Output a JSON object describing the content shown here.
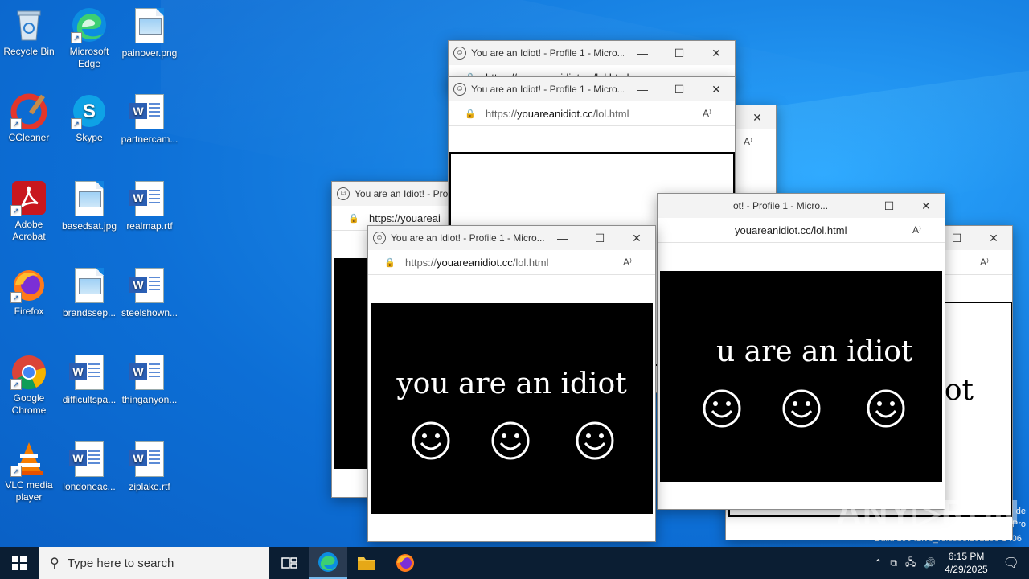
{
  "desktop": {
    "icons": [
      {
        "label": "Recycle Bin",
        "icon": "recycle-bin-icon"
      },
      {
        "label": "Microsoft Edge",
        "icon": "edge-icon"
      },
      {
        "label": "painover.png",
        "icon": "image-file-icon"
      },
      {
        "label": "CCleaner",
        "icon": "ccleaner-icon"
      },
      {
        "label": "Skype",
        "icon": "skype-icon"
      },
      {
        "label": "partnercam...",
        "icon": "word-file-icon"
      },
      {
        "label": "Adobe Acrobat",
        "icon": "acrobat-icon"
      },
      {
        "label": "basedsat.jpg",
        "icon": "image-file-icon"
      },
      {
        "label": "realmap.rtf",
        "icon": "word-file-icon"
      },
      {
        "label": "Firefox",
        "icon": "firefox-icon"
      },
      {
        "label": "brandssep...",
        "icon": "image-file-icon"
      },
      {
        "label": "steelshown...",
        "icon": "word-file-icon"
      },
      {
        "label": "Google Chrome",
        "icon": "chrome-icon"
      },
      {
        "label": "difficultspa...",
        "icon": "word-file-icon"
      },
      {
        "label": "thinganyon...",
        "icon": "word-file-icon"
      },
      {
        "label": "VLC media player",
        "icon": "vlc-icon"
      },
      {
        "label": "londoneac...",
        "icon": "word-file-icon"
      },
      {
        "label": "ziplake.rtf",
        "icon": "word-file-icon"
      }
    ]
  },
  "browser": {
    "title": "You are an Idiot! - Profile 1 - Micro...",
    "title_partial_left": "You are an Idiot! - Profi",
    "title_partial_right": "ot! - Profile 1 - Micro...",
    "url_proto": "https://",
    "url_domain": "youareanidiot.cc",
    "url_path": "/lol.html",
    "url_partial": "https://youareai",
    "url_partial_right": "youareanidiot.cc/lol.html",
    "url_top_cut": "https://youareanidiot.cc/lol.html",
    "message": "you are an idiot",
    "message_partial": "u are an idiot",
    "message_cut": "iot",
    "message_cut2": "ot",
    "read_aloud": "A⁾",
    "minimize": "—",
    "maximize": "☐",
    "close": "✕"
  },
  "taskbar": {
    "search_placeholder": "Type here to search",
    "time": "6:15 PM",
    "date": "4/29/2025"
  },
  "watermark": {
    "text": "ANY▷RUN",
    "build": "Build 19041.vb_release.191206-1406",
    "edge1": "de",
    "edge2": "Pro"
  }
}
